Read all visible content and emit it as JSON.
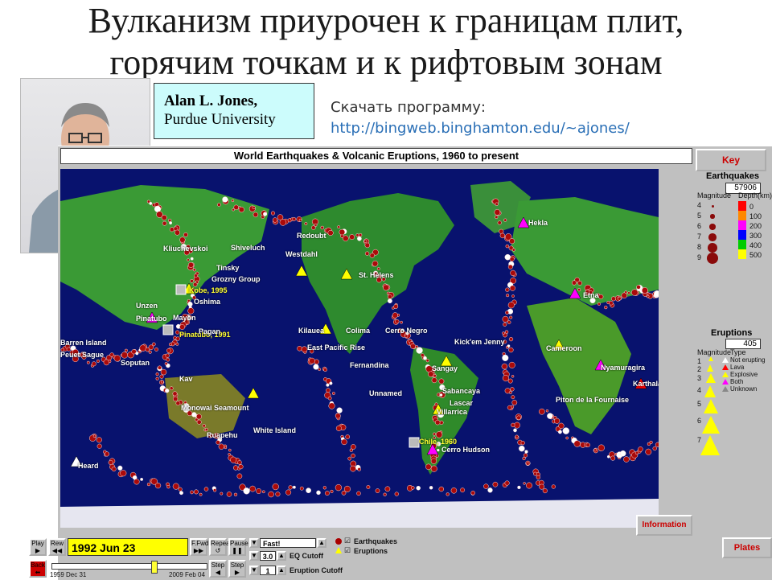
{
  "slide": {
    "title_line1": "Вулканизм приурочен к границам плит,",
    "title_line2": "горячим точкам и к рифтовым зонам"
  },
  "credit": {
    "name": "Alan L. Jones,",
    "institution": "Purdue University"
  },
  "download": {
    "label": "Скачать программу:",
    "url": "http://bingweb.binghamton.edu/~ajones/"
  },
  "app": {
    "title": "World Earthquakes & Volcanic Eruptions, 1960 to present",
    "key_button": "Key",
    "info_button": "Information",
    "plates_button": "Plates",
    "earthquakes": {
      "title": "Earthquakes",
      "count": "57906",
      "magnitude_label": "Magnitude",
      "depth_label": "Depth(km)",
      "magnitudes": [
        "4",
        "5",
        "6",
        "7",
        "8",
        "9"
      ],
      "depths": [
        "0",
        "100",
        "200",
        "300",
        "400",
        "500"
      ],
      "depth_colors": [
        "#ff0000",
        "#ff8800",
        "#ff00ff",
        "#0000ff",
        "#00cc00",
        "#ffff00"
      ]
    },
    "eruptions": {
      "title": "Eruptions",
      "count": "405",
      "magnitude_label": "Magnitude",
      "type_label": "Type",
      "magnitudes": [
        "1",
        "2",
        "3",
        "4",
        "5",
        "6",
        "7"
      ],
      "types": [
        "Not erupting",
        "Lava",
        "Explosive",
        "Both",
        "Unknown"
      ],
      "type_colors": [
        "#ffffff",
        "#ff0000",
        "#ffff00",
        "#ff00ff",
        "#888888"
      ]
    },
    "controls": {
      "play": "Play",
      "rew": "Rew",
      "date": "1992 Jun 23",
      "ffwd": "F.Fwd",
      "repeat": "Repeat",
      "pause": "Pause",
      "back": "Back",
      "step1": "Step",
      "step2": "Step",
      "speed": "Fast!",
      "eq_cutoff_value": "3.0",
      "eq_cutoff_label": "EQ Cutoff",
      "eruption_cutoff_value": "1",
      "eruption_cutoff_label": "Eruption Cutoff",
      "earthquakes_label": "Earthquakes",
      "eruptions_label": "Eruptions",
      "start_date": "1959 Dec 31",
      "end_date": "2009 Feb 04"
    },
    "map_labels": {
      "hekla": "Hekla",
      "redoubt": "Redoubt",
      "shiveluch": "Shiveluch",
      "kliuchevskoi": "Kliuchevskoi",
      "westdahl": "Westdahl",
      "tinsky": "Tinsky",
      "grozny": "Grozny Group",
      "kobe": "Kobe, 1995",
      "oshima": "Oshima",
      "unzen": "Unzen",
      "st_helens": "St. Helens",
      "etna": "Etna",
      "kilauea": "Kilauea",
      "colima": "Colima",
      "cerro_negro": "Cerro Negro",
      "kick_em": "Kick'em Jenny",
      "pinatubo": "Pinatubo",
      "pinatubo_1991": "Pinatubo, 1991",
      "barren": "Barren Island",
      "pagan": "Pagan",
      "peuet": "Peuet Sague",
      "soputan": "Soputan",
      "kavachi": "Kav",
      "east_pacific": "East Pacific Rise",
      "fernandina": "Fernandina",
      "sangay": "Sangay",
      "cameroon": "Cameroon",
      "nyamuragira": "Nyamuragira",
      "karthala": "Karthala",
      "unnamed": "Unnamed",
      "sabancaya": "Sabancaya",
      "lascar": "Lascar",
      "piton": "Piton de la Fournaise",
      "monowai": "Monowai Seamount",
      "white_island": "White Island",
      "ruapehu": "Ruapehu",
      "villarrica": "Villarrica",
      "chile": "Chile, 1960",
      "cerro_hudson": "Cerro Hudson",
      "heard": "Heard",
      "mayon": "Mayon"
    }
  }
}
